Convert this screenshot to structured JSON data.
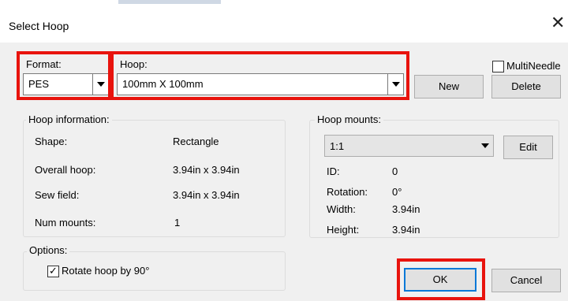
{
  "dialog": {
    "title": "Select Hoop",
    "close_glyph": "✕"
  },
  "format": {
    "label": "Format:",
    "value": "PES"
  },
  "hoop": {
    "label": "Hoop:",
    "value": "100mm X 100mm"
  },
  "multineedle": {
    "label": "MultiNeedle",
    "checked": false
  },
  "buttons": {
    "new": "New",
    "delete": "Delete",
    "edit": "Edit",
    "ok": "OK",
    "cancel": "Cancel"
  },
  "hoop_info": {
    "title": "Hoop information:",
    "rows": [
      {
        "label": "Shape:",
        "value": "Rectangle"
      },
      {
        "label": "Overall hoop:",
        "value": "3.94in x 3.94in"
      },
      {
        "label": "Sew field:",
        "value": "3.94in x 3.94in"
      },
      {
        "label": "Num mounts:",
        "value": "1"
      }
    ]
  },
  "hoop_mounts": {
    "title": "Hoop mounts:",
    "selected": "1:1",
    "rows": [
      {
        "label": "ID:",
        "value": "0"
      },
      {
        "label": "Rotation:",
        "value": "0°"
      },
      {
        "label": "Width:",
        "value": "3.94in"
      },
      {
        "label": "Height:",
        "value": "3.94in"
      }
    ]
  },
  "options": {
    "title": "Options:",
    "rotate_label": "Rotate hoop by 90°",
    "rotate_checked": true,
    "check_glyph": "✓"
  },
  "colors": {
    "highlight": "#e8130d",
    "default_button_border": "#0078d7",
    "dialog_bg": "#f0f0f0"
  }
}
